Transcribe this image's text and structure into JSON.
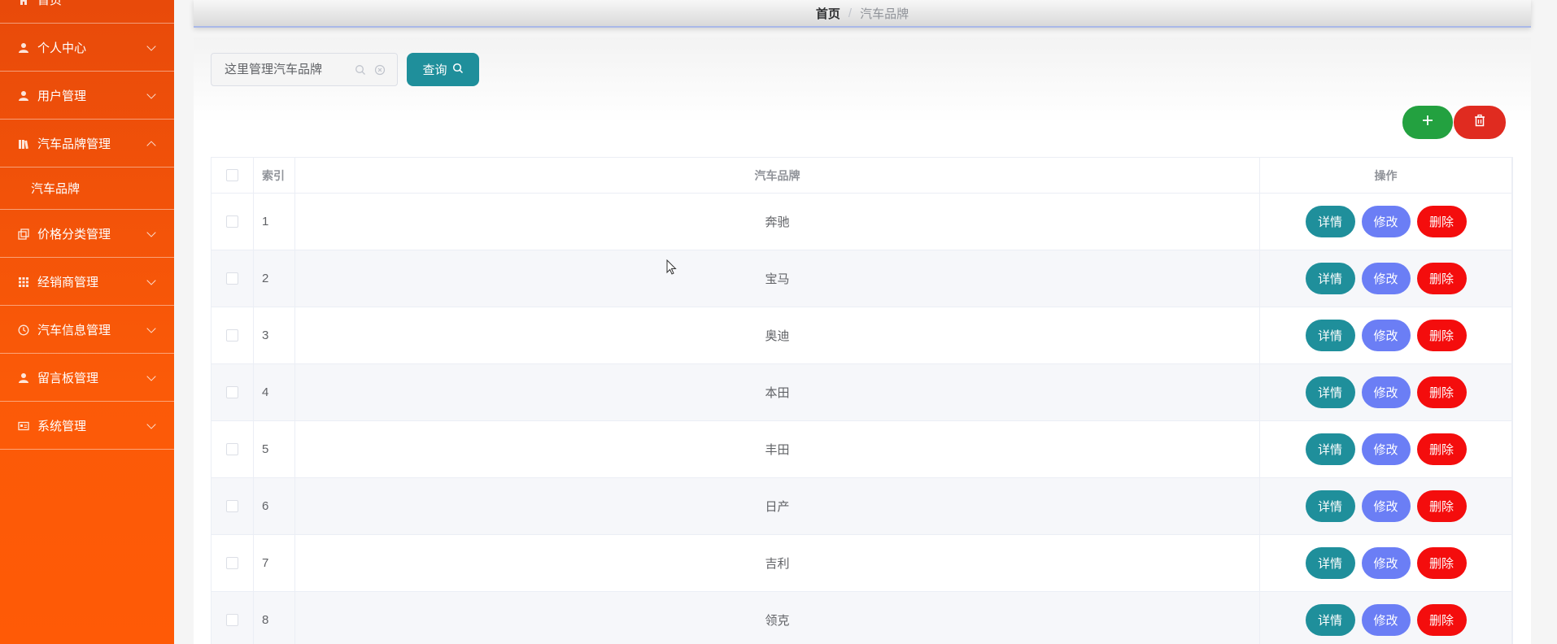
{
  "sidebar": {
    "items": [
      {
        "label": "首页",
        "icon": "home-icon"
      },
      {
        "label": "个人中心",
        "icon": "user-icon"
      },
      {
        "label": "用户管理",
        "icon": "user-icon"
      },
      {
        "label": "汽车品牌管理",
        "icon": "books-icon",
        "expanded": true
      },
      {
        "label": "汽车品牌",
        "sub": true
      },
      {
        "label": "价格分类管理",
        "icon": "copy-icon"
      },
      {
        "label": "经销商管理",
        "icon": "grid-icon"
      },
      {
        "label": "汽车信息管理",
        "icon": "clock-icon"
      },
      {
        "label": "留言板管理",
        "icon": "user-icon"
      },
      {
        "label": "系统管理",
        "icon": "card-icon"
      }
    ]
  },
  "breadcrumb": {
    "home": "首页",
    "separator": "/",
    "current": "汽车品牌"
  },
  "search": {
    "placeholder": "这里管理汽车品牌",
    "button_label": "查询"
  },
  "table": {
    "headers": {
      "index": "索引",
      "brand": "汽车品牌",
      "ops": "操作"
    },
    "rows": [
      {
        "index": "1",
        "brand": "奔驰"
      },
      {
        "index": "2",
        "brand": "宝马"
      },
      {
        "index": "3",
        "brand": "奥迪"
      },
      {
        "index": "4",
        "brand": "本田"
      },
      {
        "index": "5",
        "brand": "丰田"
      },
      {
        "index": "6",
        "brand": "日产"
      },
      {
        "index": "7",
        "brand": "吉利"
      },
      {
        "index": "8",
        "brand": "领克"
      }
    ],
    "ops": {
      "detail": "详情",
      "edit": "修改",
      "delete": "删除"
    }
  },
  "colors": {
    "sidebar": "#ff5a06",
    "primary": "#1f8f9b",
    "edit": "#6b7ef5",
    "danger": "#f40d0d",
    "add": "#23a140"
  }
}
